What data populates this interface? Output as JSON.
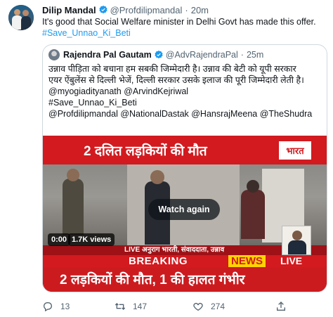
{
  "tweet": {
    "author_name": "Dilip Mandal",
    "handle": "@Profdilipmandal",
    "separator": "·",
    "time": "20m",
    "text": "It's good that Social Welfare minister in Delhi Govt has made this offer.",
    "hashtag": "#Save_Unnao_Ki_Beti"
  },
  "quote": {
    "author_name": "Rajendra Pal Gautam",
    "handle": "@AdvRajendraPal",
    "separator": "·",
    "time": "25m",
    "lines": [
      "उन्नाव पीड़िता को बचाना हम सबकी जिम्मेदारी है। उन्नाव की बेटी को यूपी सरकार",
      "एयर ऐंबुलेंस से दिल्ली भेजें, दिल्ली सरकार उसके इलाज की पूरी जिम्मेदारी लेती है।"
    ],
    "mentions_1": "@myogiadityanath @ArvindKejriwal",
    "hashtag": "#Save_Unnao_Ki_Beti",
    "mentions_2": "@Profdilipmandal @NationalDastak @HansrajMeena @TheShudra"
  },
  "video": {
    "headline": "2 दलित लड़कियों की मौत",
    "channel_logo": "भारत",
    "live_strip": "LIVE  अनुराग भारती, संवाददाता, उन्नाव",
    "breaking": "BREAKING",
    "news": "NEWS",
    "live": "LIVE",
    "ticker": "2 लड़कियों की मौत, 1 की हालत गंभीर",
    "watch_again": "Watch again",
    "duration": "0:00",
    "views": "1.7K views"
  },
  "actions": {
    "replies": "13",
    "retweets": "147",
    "likes": "274"
  },
  "colors": {
    "accent": "#1d9bf0",
    "muted": "#536471",
    "news_red": "#d21a1f"
  }
}
